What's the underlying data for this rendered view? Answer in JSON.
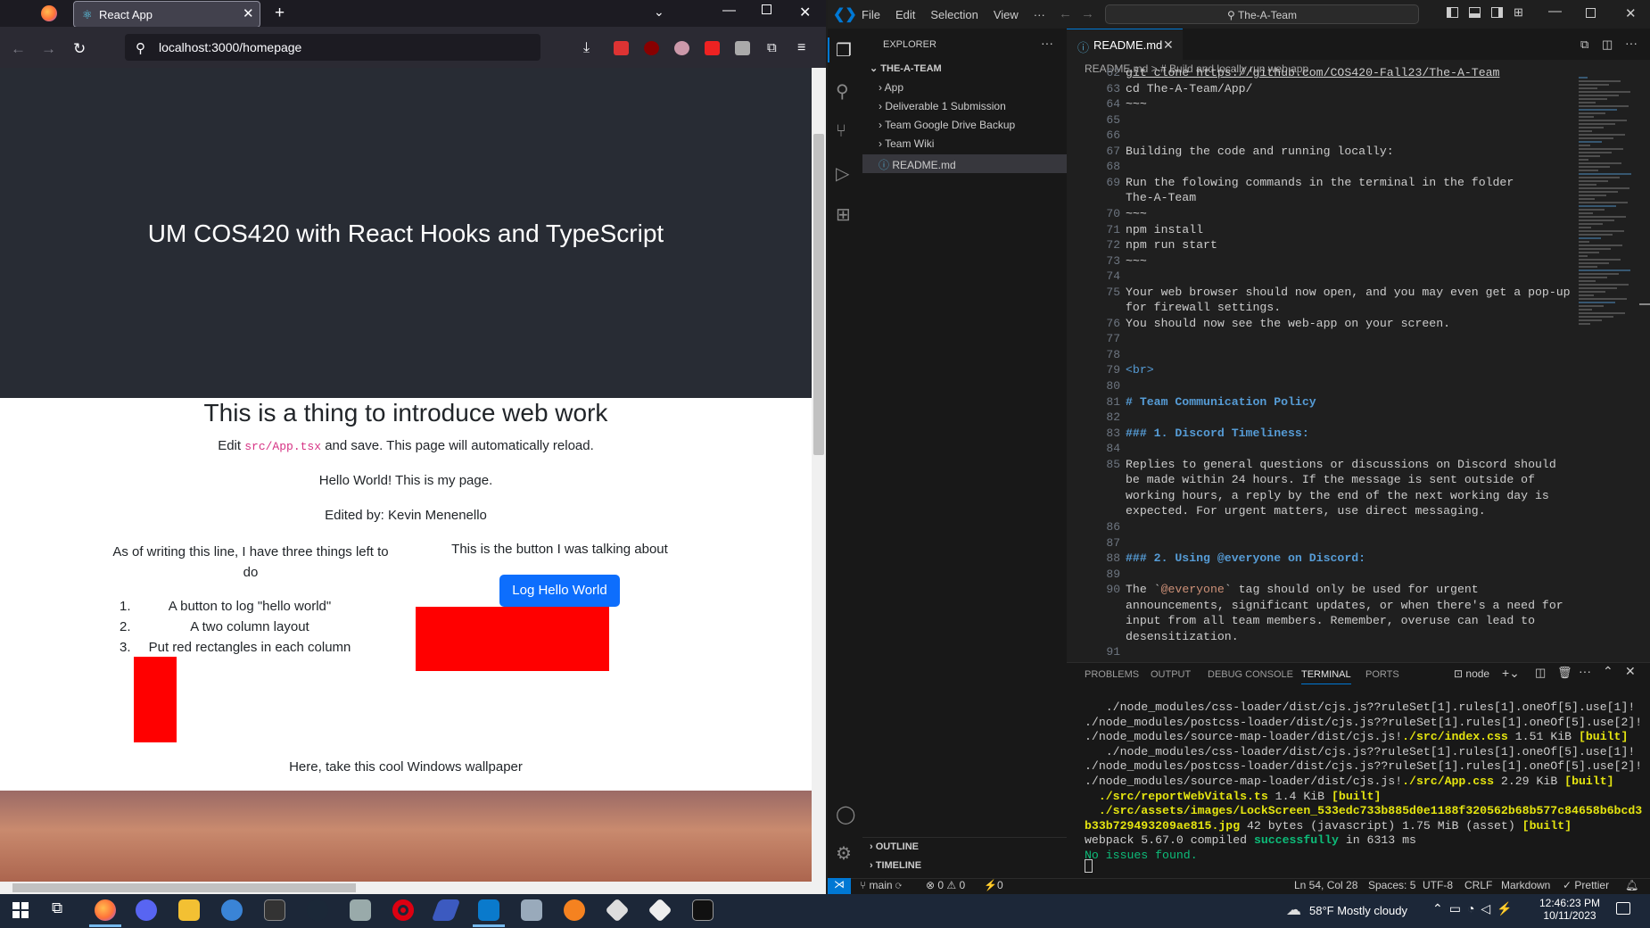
{
  "browser": {
    "tab_title": "React App",
    "url": "localhost:3000/homepage",
    "page": {
      "hero_title": "UM COS420 with React Hooks and TypeScript",
      "heading": "This is a thing to introduce web work",
      "edit_prefix": "Edit ",
      "edit_code": "src/App.tsx",
      "edit_suffix": " and save. This page will automatically reload.",
      "hello": "Hello World! This is my page.",
      "edited_by": "Edited by: Kevin Menenello",
      "left_col_text": "As of writing this line, I have three things left to do",
      "todo": [
        "A button to log \"hello world\"",
        "A two column layout",
        "Put red rectangles in each column"
      ],
      "right_col_text": "This is the button I was talking about",
      "button_label": "Log Hello World",
      "wallpaper_text": "Here, take this cool Windows wallpaper"
    }
  },
  "vscode": {
    "menu": [
      "File",
      "Edit",
      "Selection",
      "View",
      "···"
    ],
    "command_center": "The-A-Team",
    "explorer_title": "EXPLORER",
    "root": "THE-A-TEAM",
    "tree": [
      "App",
      "Deliverable 1 Submission",
      "Team Google Drive Backup",
      "Team Wiki",
      "README.md"
    ],
    "outline": "OUTLINE",
    "timeline": "TIMELINE",
    "tab": "README.md",
    "breadcrumb": "README.md > # Build and locally run web app",
    "lines": [
      {
        "n": "62",
        "t": "git clone https://github.com/COS420-Fall23/The-A-Team"
      },
      {
        "n": "63",
        "t": "cd The-A-Team/App/"
      },
      {
        "n": "64",
        "t": "~~~"
      },
      {
        "n": "65",
        "t": ""
      },
      {
        "n": "66",
        "t": ""
      },
      {
        "n": "67",
        "t": "Building the code and running locally:"
      },
      {
        "n": "68",
        "t": ""
      },
      {
        "n": "69",
        "t": "Run the folowing commands in the terminal in the folder"
      },
      {
        "n": "",
        "t": "The-A-Team"
      },
      {
        "n": "70",
        "t": "~~~"
      },
      {
        "n": "71",
        "t": "npm install"
      },
      {
        "n": "72",
        "t": "npm run start"
      },
      {
        "n": "73",
        "t": "~~~"
      },
      {
        "n": "74",
        "t": ""
      },
      {
        "n": "75",
        "t": "Your web browser should now open, and you may even get a pop-up"
      },
      {
        "n": "",
        "t": "for firewall settings."
      },
      {
        "n": "76",
        "t": "You should now see the web-app on your screen."
      },
      {
        "n": "77",
        "t": ""
      },
      {
        "n": "78",
        "t": ""
      },
      {
        "n": "79",
        "t": "<br>",
        "c": "tag"
      },
      {
        "n": "80",
        "t": ""
      },
      {
        "n": "81",
        "t": "# Team Communication Policy",
        "c": "hd"
      },
      {
        "n": "82",
        "t": ""
      },
      {
        "n": "83",
        "t": "### 1. Discord Timeliness:",
        "c": "hd"
      },
      {
        "n": "84",
        "t": ""
      },
      {
        "n": "85",
        "t": "Replies to general questions or discussions on Discord should"
      },
      {
        "n": "",
        "t": "be made within 24 hours. If the message is sent outside of"
      },
      {
        "n": "",
        "t": "working hours, a reply by the end of the next working day is"
      },
      {
        "n": "",
        "t": "expected. For urgent matters, use direct messaging."
      },
      {
        "n": "86",
        "t": ""
      },
      {
        "n": "87",
        "t": ""
      },
      {
        "n": "88",
        "t": "### 2. Using @everyone on Discord:",
        "c": "hd"
      },
      {
        "n": "89",
        "t": ""
      },
      {
        "n": "90",
        "t": "The `@everyone` tag should only be used for urgent"
      },
      {
        "n": "",
        "t": "announcements, significant updates, or when there's a need for"
      },
      {
        "n": "",
        "t": "input from all team members. Remember, overuse can lead to"
      },
      {
        "n": "",
        "t": "desensitization."
      },
      {
        "n": "91",
        "t": ""
      }
    ],
    "panel_tabs": [
      "PROBLEMS",
      "OUTPUT",
      "DEBUG CONSOLE",
      "TERMINAL",
      "PORTS"
    ],
    "terminal_profile": "node",
    "terminal": [
      "   ./node_modules/css-loader/dist/cjs.js??ruleSet[1].rules[1].oneOf[5].use[1]!",
      "./node_modules/postcss-loader/dist/cjs.js??ruleSet[1].rules[1].oneOf[5].use[2]!",
      "./node_modules/source-map-loader/dist/cjs.js!./src/index.css 1.51 KiB [built]",
      "   ./node_modules/css-loader/dist/cjs.js??ruleSet[1].rules[1].oneOf[5].use[1]!",
      "./node_modules/postcss-loader/dist/cjs.js??ruleSet[1].rules[1].oneOf[5].use[2]!",
      "./node_modules/source-map-loader/dist/cjs.js!./src/App.css 2.29 KiB [built]",
      "  ./src/reportWebVitals.ts 1.4 KiB [built]",
      "  ./src/assets/images/LockScreen_533edc733b885d0e1188f320562b68b577c84658b6bcd3",
      "b33b729493209ae815.jpg 42 bytes (javascript) 1.75 MiB (asset) [built]",
      "webpack 5.67.0 compiled successfully in 6313 ms",
      "No issues found."
    ],
    "status": {
      "branch": "main",
      "problems": "⊗ 0 ⚠ 0",
      "ports": "⚡0",
      "position": "Ln 54, Col 28",
      "spaces": "Spaces: 5",
      "encoding": "UTF-8",
      "eol": "CRLF",
      "language": "Markdown",
      "prettier": "✓ Prettier"
    }
  },
  "taskbar": {
    "weather": "58°F  Mostly cloudy",
    "time": "12:46:23 PM",
    "date": "10/11/2023"
  }
}
